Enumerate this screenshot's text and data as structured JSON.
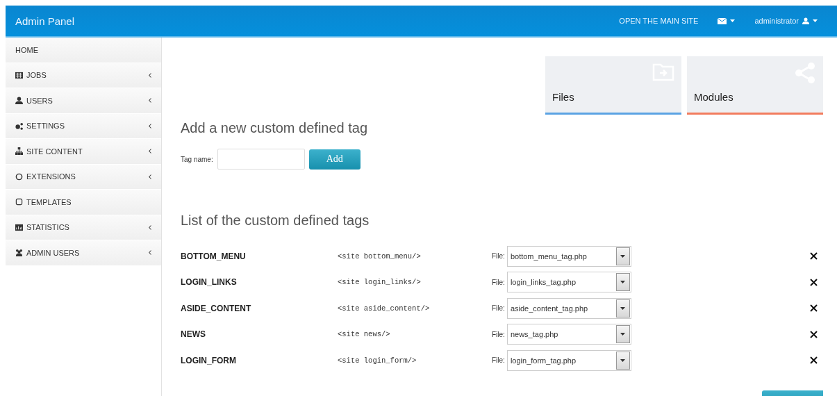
{
  "header": {
    "title": "Admin Panel",
    "links": [
      "OPEN THE MAIN SITE"
    ],
    "user": "administrator"
  },
  "sidebar": {
    "items": [
      {
        "label": "HOME",
        "expandable": false
      },
      {
        "label": "JOBS",
        "expandable": true
      },
      {
        "label": "USERS",
        "expandable": true
      },
      {
        "label": "SETTINGS",
        "expandable": true
      },
      {
        "label": "SITE CONTENT",
        "expandable": true
      },
      {
        "label": "EXTENSIONS",
        "expandable": true
      },
      {
        "label": "TEMPLATES",
        "expandable": false
      },
      {
        "label": "STATISTICS",
        "expandable": true
      },
      {
        "label": "ADMIN USERS",
        "expandable": true
      }
    ]
  },
  "tiles": [
    {
      "label": "Files",
      "color": "#5aa3e3"
    },
    {
      "label": "Modules",
      "color": "#f27c5e"
    }
  ],
  "add_form": {
    "heading": "Add a new custom defined tag",
    "field_label": "Tag name:",
    "button": "Add"
  },
  "list": {
    "heading": "List of the custom defined tags",
    "rows": [
      {
        "name": "BOTTOM_MENU",
        "code": "<site bottom_menu/>",
        "file_label": "File:",
        "file": "bottom_menu_tag.php"
      },
      {
        "name": "LOGIN_LINKS",
        "code": "<site login_links/>",
        "file_label": "File:",
        "file": "login_links_tag.php"
      },
      {
        "name": "ASIDE_CONTENT",
        "code": "<site aside_content/>",
        "file_label": "File:",
        "file": "aside_content_tag.php"
      },
      {
        "name": "NEWS",
        "code": "<site news/>",
        "file_label": "File:",
        "file": "news_tag.php"
      },
      {
        "name": "LOGIN_FORM",
        "code": "<site login_form/>",
        "file_label": "File:",
        "file": "login_form_tag.php"
      }
    ]
  }
}
